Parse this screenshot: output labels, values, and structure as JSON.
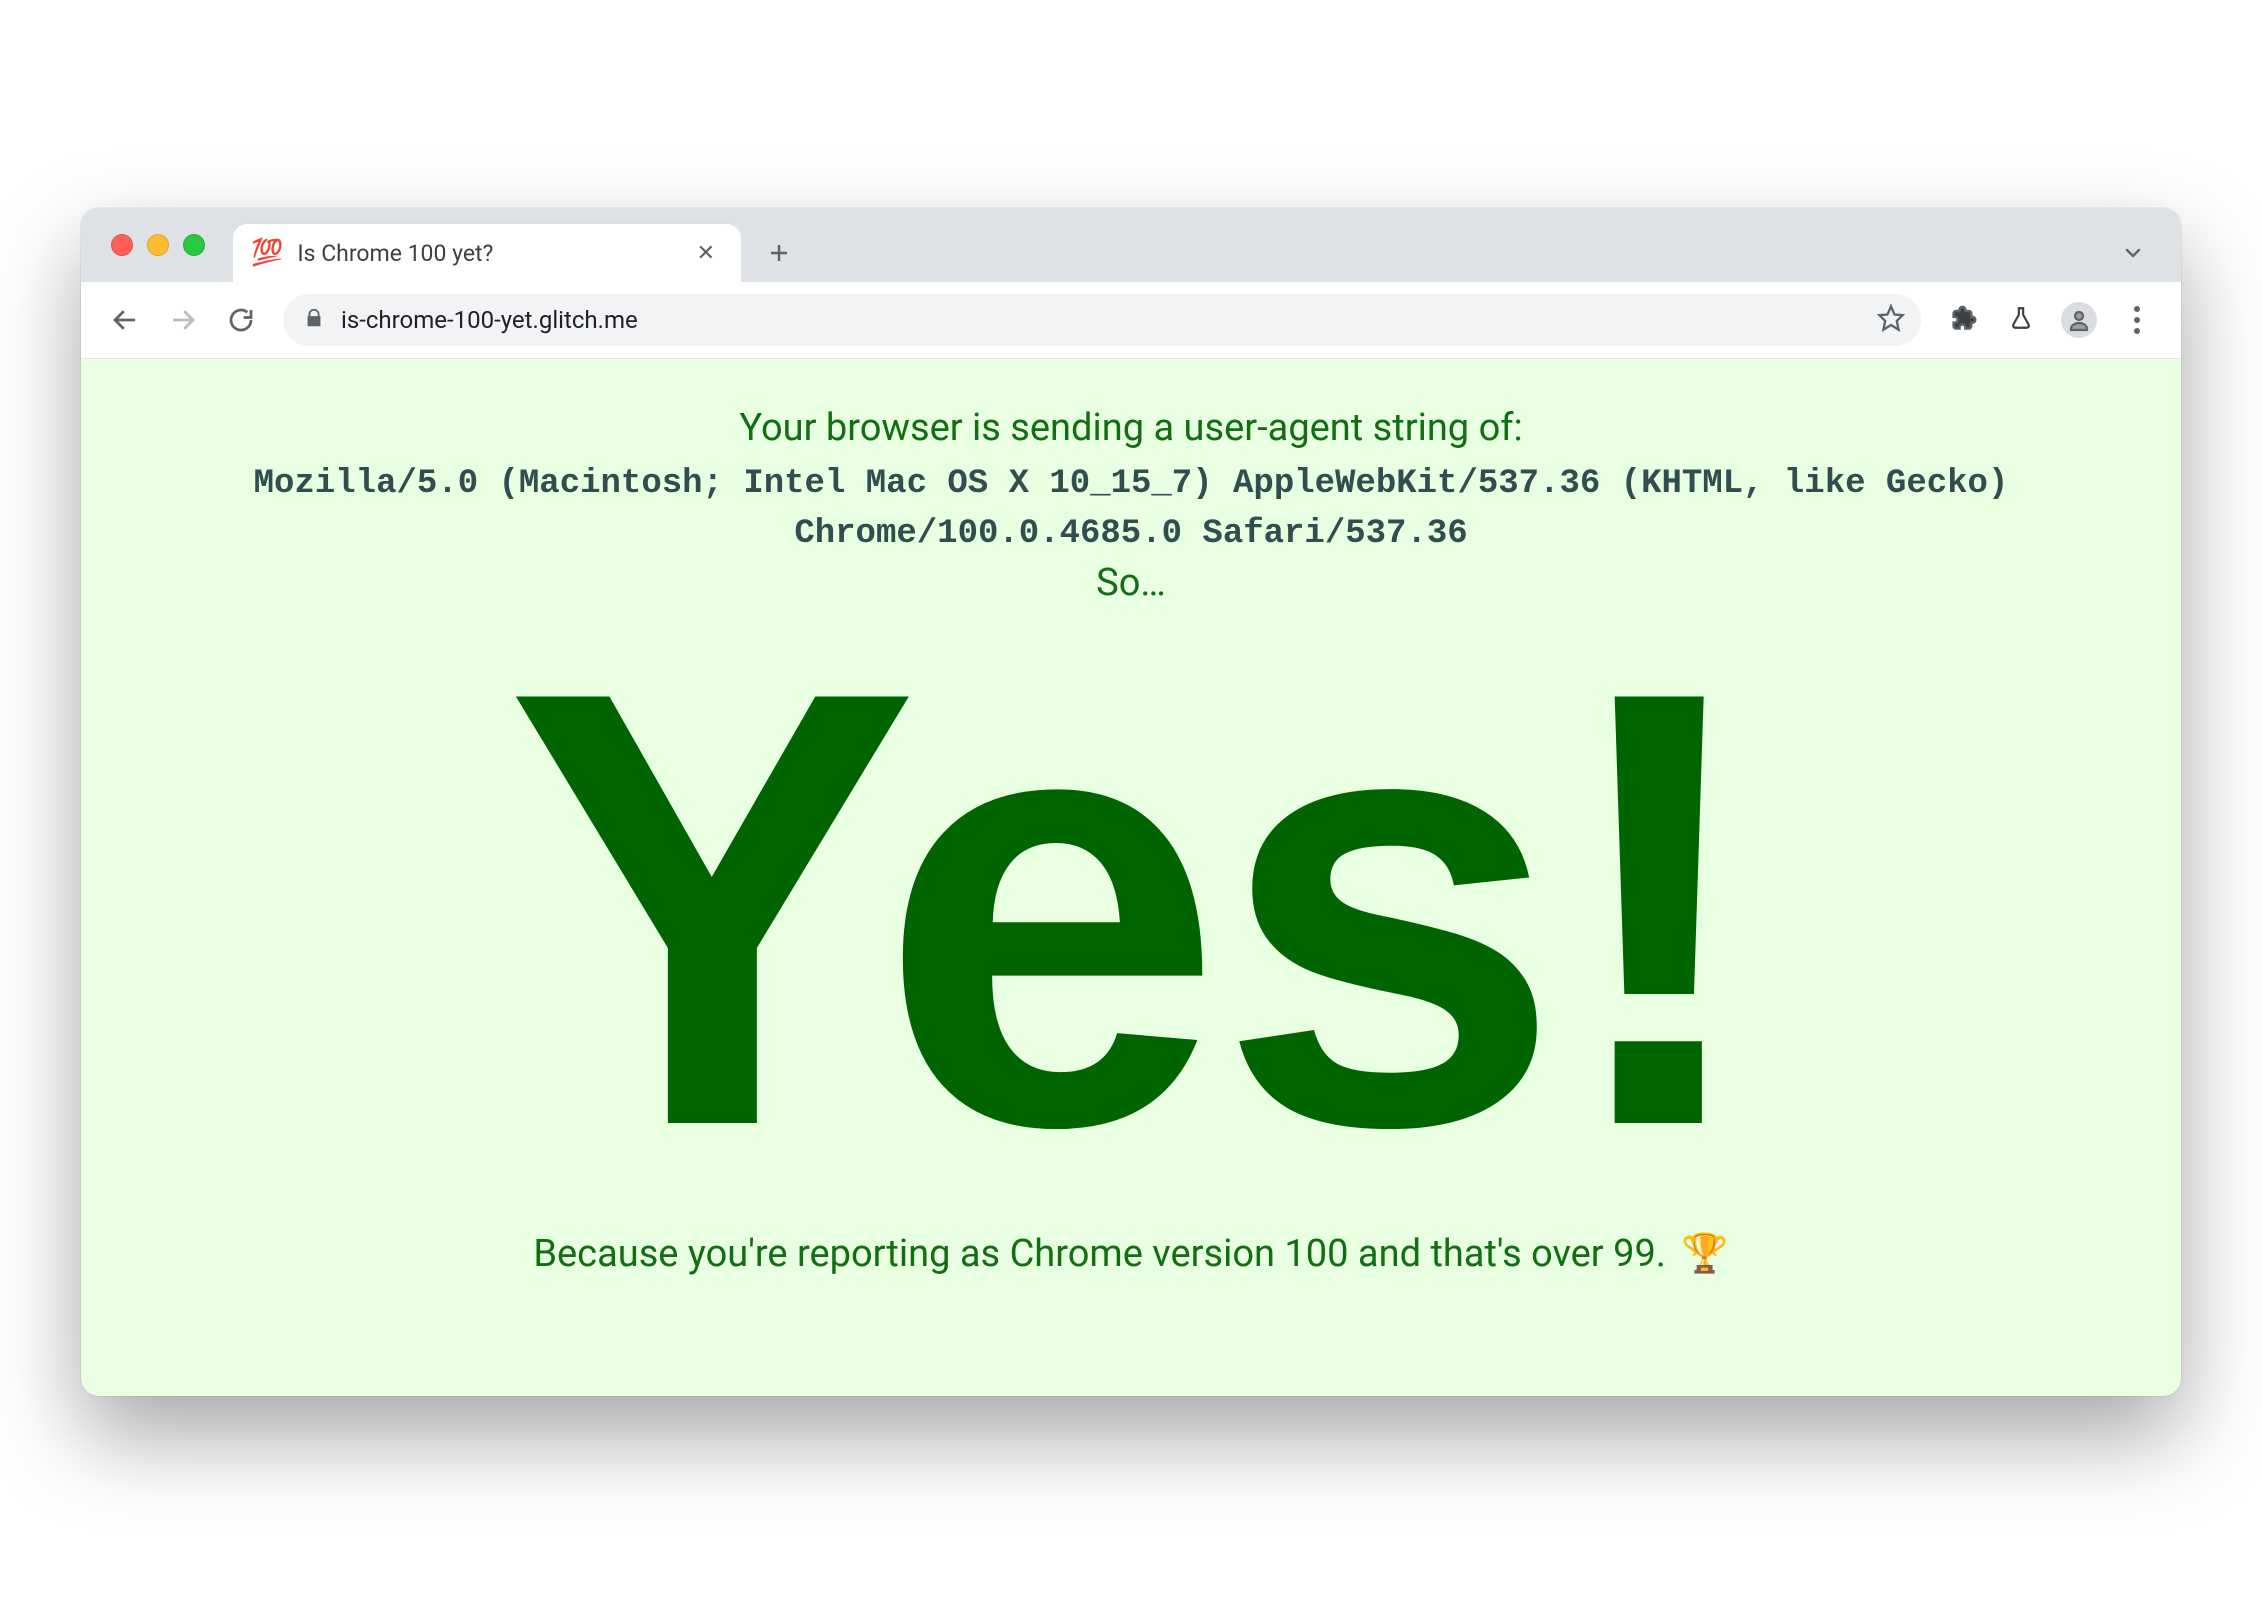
{
  "window": {
    "tab": {
      "favicon": "💯",
      "title": "Is Chrome 100 yet?"
    }
  },
  "toolbar": {
    "url": "is-chrome-100-yet.glitch.me"
  },
  "page": {
    "intro": "Your browser is sending a user-agent string of:",
    "ua": "Mozilla/5.0 (Macintosh; Intel Mac OS X 10_15_7) AppleWebKit/537.36 (KHTML, like Gecko) Chrome/100.0.4685.0 Safari/537.36",
    "so": "So…",
    "answer": "Yes!",
    "reason_text": "Because you're reporting as Chrome version 100 and that's over 99.",
    "trophy": "🏆"
  }
}
